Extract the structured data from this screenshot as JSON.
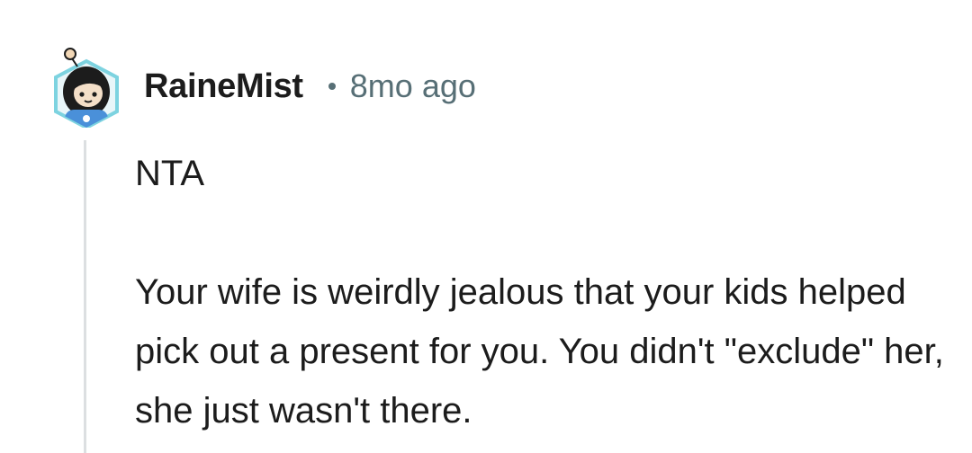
{
  "comment": {
    "author": "RaineMist",
    "separator_icon": "dot-separator-icon",
    "timestamp": "8mo ago",
    "avatar_icon": "snoo-avatar-icon",
    "body": {
      "paragraph_1": "NTA",
      "paragraph_2": "Your wife is weirdly jealous that your kids helped pick out a present for you. You didn't \"exclude\" her, she just wasn't there."
    }
  },
  "colors": {
    "text": "#1c1c1c",
    "meta": "#576f76",
    "thread_line": "#dcdfe1",
    "avatar_border": "#7dd3e0",
    "avatar_shirt": "#4a90d9"
  }
}
